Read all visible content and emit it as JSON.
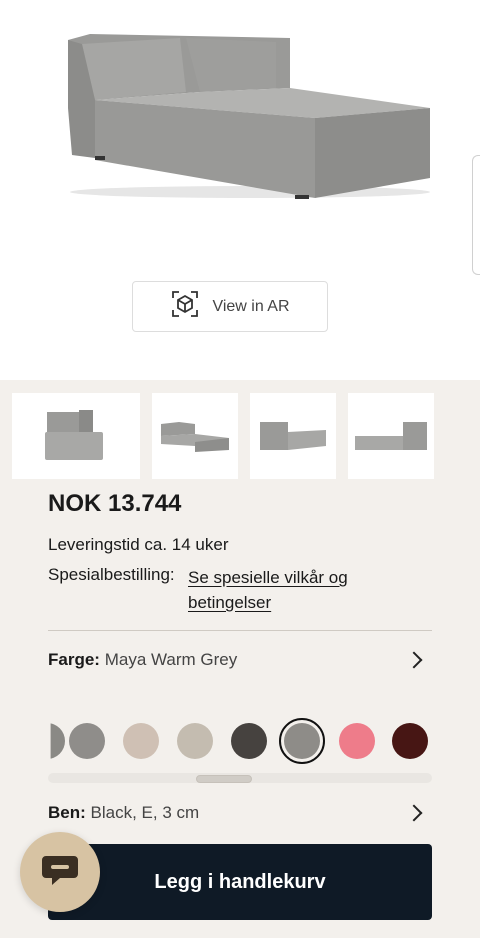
{
  "ar_button": {
    "label": "View in AR",
    "icon": "ar-cube-icon"
  },
  "product": {
    "price": "NOK 13.744",
    "delivery": "Leveringstid ca. 14 uker",
    "special_label": "Spesialbestilling:",
    "special_link": "Se spesielle vilkår og betingelser"
  },
  "color_row": {
    "label": "Farge:",
    "value": "Maya Warm Grey"
  },
  "swatches": [
    {
      "color": "#8a8985"
    },
    {
      "color": "#8f8d8a"
    },
    {
      "color": "#cfc0b4"
    },
    {
      "color": "#c4bcb0"
    },
    {
      "color": "#46423f"
    },
    {
      "color": "#8e8c88",
      "selected": true
    },
    {
      "color": "#ee7c8a"
    },
    {
      "color": "#471614"
    }
  ],
  "legs_row": {
    "label": "Ben:",
    "value": "Black, E, 3 cm"
  },
  "cart_button": {
    "label": "Legg i handlekurv"
  },
  "chat_button": {
    "icon": "chat-bubble-icon"
  },
  "colors": {
    "accent": "#0f1a26",
    "background": "#f3f0ec",
    "chat": "#d7c3a3"
  }
}
